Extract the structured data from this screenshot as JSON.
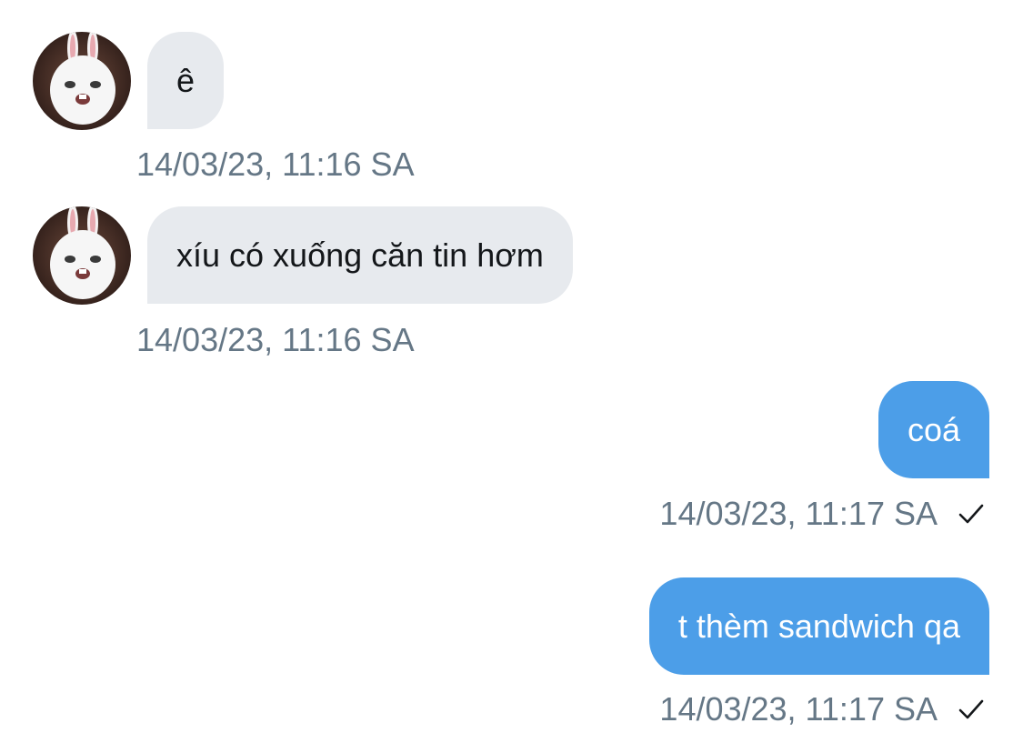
{
  "colors": {
    "incoming_bubble": "#e7eaee",
    "outgoing_bubble": "#4c9ee8",
    "timestamp_text": "#657786",
    "incoming_text": "#14171a",
    "outgoing_text": "#ffffff"
  },
  "messages": [
    {
      "direction": "incoming",
      "avatar_icon": "bunny-avatar-icon",
      "text": "ê",
      "timestamp": "14/03/23, 11:16 SA"
    },
    {
      "direction": "incoming",
      "avatar_icon": "bunny-avatar-icon",
      "text": "xíu có xuống căn tin hơm",
      "timestamp": "14/03/23, 11:16 SA"
    },
    {
      "direction": "outgoing",
      "text": "coá",
      "timestamp": "14/03/23, 11:17 SA",
      "status_icon": "checkmark-icon"
    },
    {
      "direction": "outgoing",
      "text": "t thèm sandwich qa",
      "timestamp": "14/03/23, 11:17 SA",
      "status_icon": "checkmark-icon"
    }
  ]
}
